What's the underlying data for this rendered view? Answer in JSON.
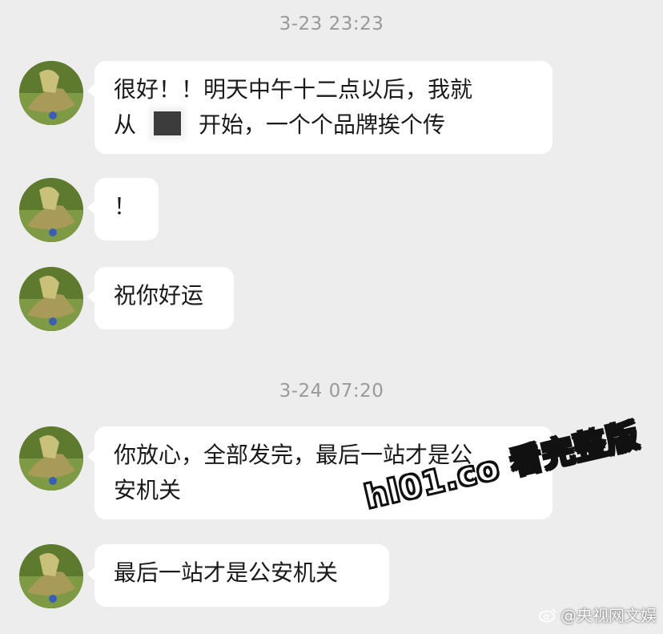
{
  "chat": {
    "groups": [
      {
        "timestamp": "3-23 23:23",
        "messages": [
          {
            "line1": "很好！！明天中午十二点以后，我就",
            "line2_prefix": "从",
            "line2_suffix": "开始，一个个品牌挨个传"
          },
          {
            "text": "！"
          },
          {
            "text": "祝你好运"
          }
        ]
      },
      {
        "timestamp": "3-24 07:20",
        "messages": [
          {
            "line1": "你放心，全部发完，最后一站才是公",
            "line2": "安机关"
          },
          {
            "text": "最后一站才是公安机关"
          }
        ]
      }
    ]
  },
  "overlay": {
    "promo_text": "hl01.co 看完整版",
    "watermark": "@央视网文娱",
    "watermark_icon": "weibo-icon"
  },
  "colors": {
    "background": "#ededed",
    "bubble": "#ffffff",
    "timestamp": "#9a9a9a"
  }
}
